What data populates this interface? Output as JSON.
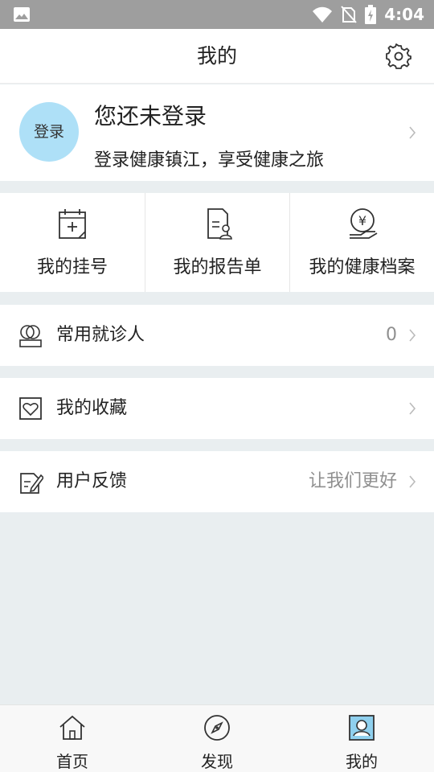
{
  "status_bar": {
    "time": "4:04"
  },
  "header": {
    "title": "我的"
  },
  "profile": {
    "avatar_label": "登录",
    "name": "您还未登录",
    "description": "登录健康镇江，享受健康之旅"
  },
  "quick_actions": [
    {
      "label": "我的挂号",
      "icon": "calendar-plus-icon"
    },
    {
      "label": "我的报告单",
      "icon": "report-document-icon"
    },
    {
      "label": "我的健康档案",
      "icon": "health-archive-coin-icon"
    }
  ],
  "menu": [
    {
      "label": "常用就诊人",
      "value": "0",
      "icon": "patients-icon"
    },
    {
      "label": "我的收藏",
      "value": "",
      "icon": "favorite-heart-icon"
    },
    {
      "label": "用户反馈",
      "value": "让我们更好",
      "icon": "feedback-edit-icon"
    }
  ],
  "tabbar": [
    {
      "label": "首页",
      "icon": "home-icon"
    },
    {
      "label": "发现",
      "icon": "compass-icon"
    },
    {
      "label": "我的",
      "icon": "profile-card-icon",
      "active": true
    }
  ],
  "colors": {
    "status_bar": "#9e9e9e",
    "avatar_bg": "#aee0f7",
    "page_bg": "#e9eef0",
    "accent": "#5bc0eb"
  }
}
